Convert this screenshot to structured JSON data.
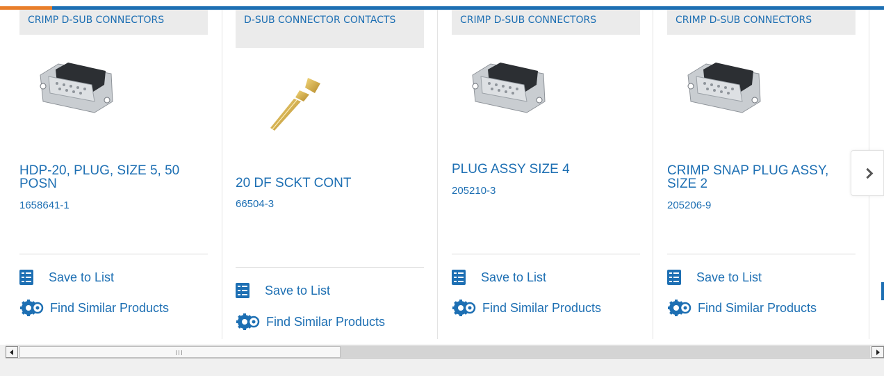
{
  "colors": {
    "accent": "#e97e2a",
    "brand": "#1d6fb3",
    "category_bg": "#ebebeb"
  },
  "products": [
    {
      "category": "CRIMP D-SUB CONNECTORS",
      "image_icon": "dsub-connector-icon",
      "title": "HDP-20, PLUG, SIZE 5, 50 POSN",
      "part_number": "1658641-1",
      "save_label": "Save to List",
      "similar_label": "Find Similar Products"
    },
    {
      "category": "D-SUB CONNECTOR CONTACTS",
      "image_icon": "crimp-contact-icon",
      "title": "20 DF SCKT CONT",
      "part_number": "66504-3",
      "save_label": "Save to List",
      "similar_label": "Find Similar Products"
    },
    {
      "category": "CRIMP D-SUB CONNECTORS",
      "image_icon": "dsub-connector-icon",
      "title": "PLUG ASSY SIZE 4",
      "part_number": "205210-3",
      "save_label": "Save to List",
      "similar_label": "Find Similar Products"
    },
    {
      "category": "CRIMP D-SUB CONNECTORS",
      "image_icon": "dsub-connector-icon",
      "title": "CRIMP SNAP PLUG ASSY, SIZE 2",
      "part_number": "205206-9",
      "save_label": "Save to List",
      "similar_label": "Find Similar Products"
    }
  ],
  "carousel": {
    "next_icon": "chevron-right-icon"
  },
  "scrollbar": {
    "position": 0.4
  }
}
